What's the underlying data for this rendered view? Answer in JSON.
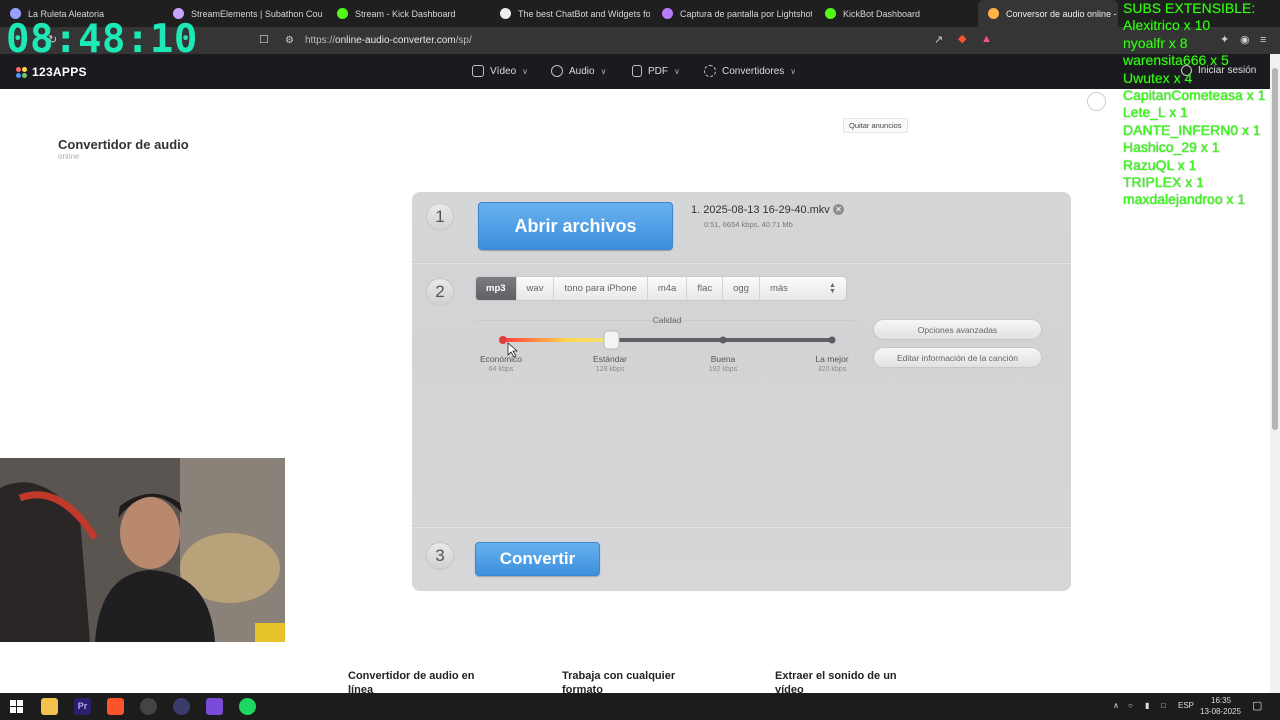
{
  "browser": {
    "tabs": [
      {
        "title": "La Ruleta Aleatoria",
        "color": "#9aa0ff",
        "active": false
      },
      {
        "title": "StreamElements | Subathon Countdo",
        "color": "#c9a3ff",
        "active": false
      },
      {
        "title": "Stream - Kick Dashboard",
        "color": "#53fc18",
        "active": false
      },
      {
        "title": "The best ChatBot and Widgets for K",
        "color": "#ffffff",
        "active": false
      },
      {
        "title": "Captura de pantalla por Lightshot",
        "color": "#b97cff",
        "active": false
      },
      {
        "title": "KickBot Dashboard",
        "color": "#53fc18",
        "active": false
      },
      {
        "title": "Conversor de audio online - Co",
        "color": "#ffb347",
        "active": true
      }
    ],
    "url_prefix": "https://",
    "url_host": "online-audio-converter.com",
    "url_path": "/sp/"
  },
  "site": {
    "logo": "123APPS",
    "nav": [
      {
        "label": "Vídeo"
      },
      {
        "label": "Audio"
      },
      {
        "label": "PDF"
      },
      {
        "label": "Convertidores"
      }
    ],
    "login": "Iniciar sesión",
    "ads_button": "Quitar anuncios",
    "title": "Convertidor de audio",
    "subtitle": "online"
  },
  "converter": {
    "step1": "1",
    "step2": "2",
    "step3": "3",
    "open_files": "Abrir archivos",
    "file_name": "1. 2025-08-13 16-29-40.mkv",
    "file_meta": "0:51, 6654 kbps, 40.71 Mb",
    "formats": [
      "mp3",
      "wav",
      "tono para iPhone",
      "m4a",
      "flac",
      "ogg",
      "más"
    ],
    "active_format": "mp3",
    "quality_label": "Calidad",
    "quality_levels": [
      {
        "label": "Económico",
        "kbps": "64 kbps"
      },
      {
        "label": "Estándar",
        "kbps": "128 kbps"
      },
      {
        "label": "Buena",
        "kbps": "192 kbps"
      },
      {
        "label": "La mejor",
        "kbps": "320 kbps"
      }
    ],
    "quality_selected_index": 1,
    "advanced_options": "Opciones avanzadas",
    "edit_info": "Editar información de la canción",
    "convert": "Convertir"
  },
  "footer": {
    "links": [
      "Convertidor de audio en línea",
      "Trabaja con cualquier formato",
      "Extraer el sonido de un vídeo"
    ]
  },
  "overlay": {
    "clock": "08:48:10",
    "subs_title": "SUBS EXTENSIBLE:",
    "subs": [
      "Alexitrico x 10",
      "nyoalfr x 8",
      "warensita666 x 5",
      "Uwutex x 4",
      "CapitanCometeasa x 1",
      "Lete_L x 1",
      "DANTE_INFERN0 x 1",
      "Hashico_29 x 1",
      "RazuQL x 1",
      "TRIPLEX x 1",
      "maxdalejandroo x 1"
    ]
  },
  "taskbar": {
    "language": "ESP",
    "time": "16:35",
    "date": "13-08-2025"
  }
}
